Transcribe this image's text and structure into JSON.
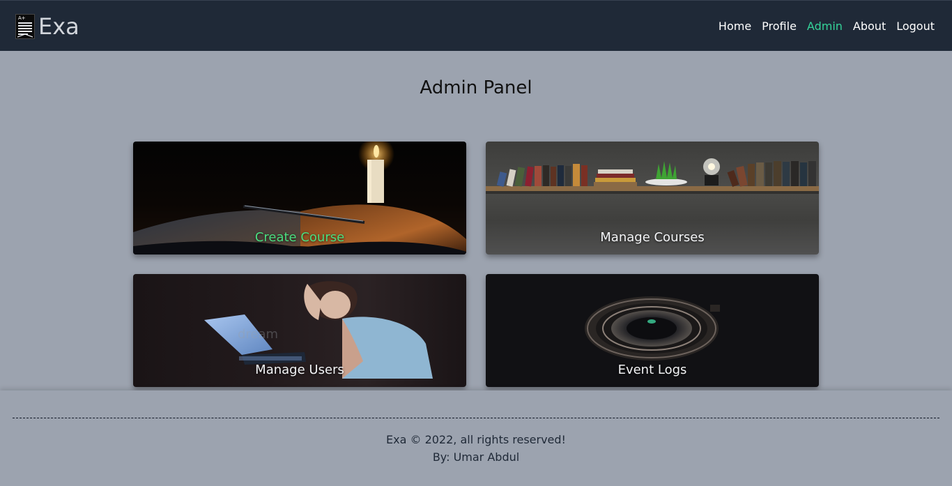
{
  "navbar": {
    "brand": "Exa",
    "logo_grade": "A+",
    "links": [
      {
        "label": "Home",
        "active": false
      },
      {
        "label": "Profile",
        "active": false
      },
      {
        "label": "Admin",
        "active": true
      },
      {
        "label": "About",
        "active": false
      },
      {
        "label": "Logout",
        "active": false
      }
    ]
  },
  "main": {
    "title": "Admin Panel",
    "cards": [
      {
        "label": "Create Course",
        "image": "candle-book-image"
      },
      {
        "label": "Manage Courses",
        "image": "bookshelf-image"
      },
      {
        "label": "Manage Users",
        "image": "person-laptop-image"
      },
      {
        "label": "Event Logs",
        "image": "camera-lens-image"
      }
    ],
    "image_watermark": "dream"
  },
  "footer": {
    "copyright": "Exa © 2022, all rights reserved!",
    "author": "By: Umar Abdul"
  },
  "colors": {
    "navbar_bg": "#1f2937",
    "page_bg": "#9ca3af",
    "accent": "#34d399"
  }
}
